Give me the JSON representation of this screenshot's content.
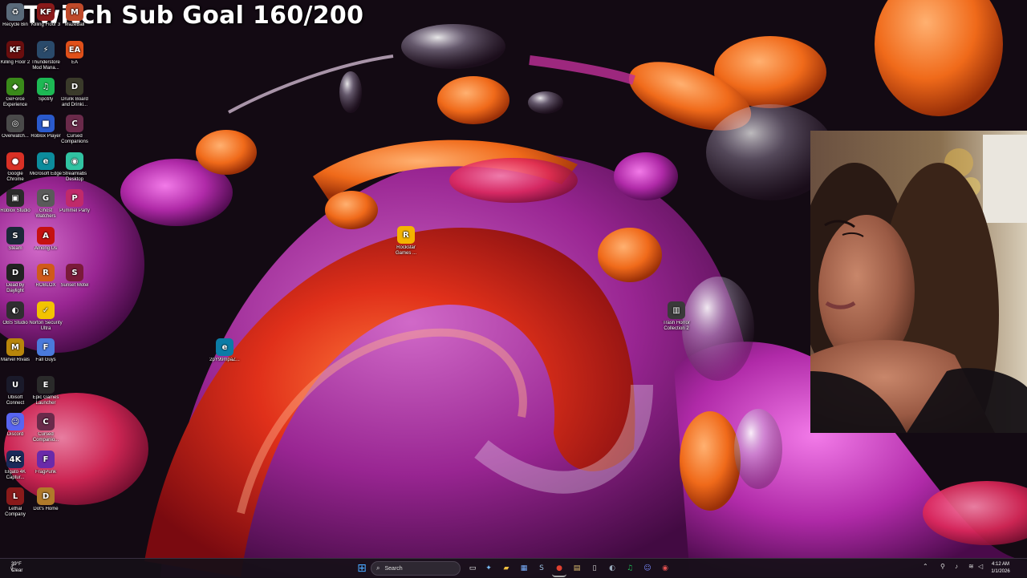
{
  "overlay": {
    "title": "Twitch Sub Goal 160/200"
  },
  "desktop": {
    "icons": [
      {
        "id": "recycle-bin",
        "label": "Recycle Bin",
        "glyph": "♻",
        "color": "#5a6a7a"
      },
      {
        "id": "killing-floor-3",
        "label": "Killing Floor 3",
        "glyph": "KF",
        "color": "#8a1a1a"
      },
      {
        "id": "mazeball",
        "label": "MazeBall",
        "glyph": "M",
        "color": "#c04a2a"
      },
      {
        "id": "killing-floor-2",
        "label": "Killing Floor 2",
        "glyph": "KF",
        "color": "#6a0e0e"
      },
      {
        "id": "thunderstore",
        "label": "Thunderstore Mod Mana...",
        "glyph": "⚡",
        "color": "#2a4a6a"
      },
      {
        "id": "ea",
        "label": "EA",
        "glyph": "EA",
        "color": "#e0501a"
      },
      {
        "id": "geforce",
        "label": "GeForce Experience",
        "glyph": "◆",
        "color": "#3a8a1a"
      },
      {
        "id": "spotify",
        "label": "Spotify",
        "glyph": "♫",
        "color": "#1db954"
      },
      {
        "id": "drunk-board",
        "label": "Drunk Board and Drinki...",
        "glyph": "D",
        "color": "#3a3a2a"
      },
      {
        "id": "overwatch",
        "label": "Overwatch...",
        "glyph": "◎",
        "color": "#4a4a4a"
      },
      {
        "id": "roblox",
        "label": "Roblox Player",
        "glyph": "■",
        "color": "#2a5acc"
      },
      {
        "id": "cursed-companions",
        "label": "Cursed Companions",
        "glyph": "C",
        "color": "#6a2a4a"
      },
      {
        "id": "chrome",
        "label": "Google Chrome",
        "glyph": "●",
        "color": "#d93025"
      },
      {
        "id": "edge",
        "label": "Microsoft Edge",
        "glyph": "e",
        "color": "#0c8c9c"
      },
      {
        "id": "streamlabs",
        "label": "Streamlabs Desktop",
        "glyph": "◉",
        "color": "#31c3a2"
      },
      {
        "id": "roblox-studio",
        "label": "Roblox Studio",
        "glyph": "▣",
        "color": "#2a2a2a"
      },
      {
        "id": "ghost-watchers",
        "label": "Ghost Watchers",
        "glyph": "G",
        "color": "#5a5a5a"
      },
      {
        "id": "pummel-party",
        "label": "Pummel Party",
        "glyph": "P",
        "color": "#c02a6a"
      },
      {
        "id": "steam",
        "label": "Steam",
        "glyph": "S",
        "color": "#1b2838"
      },
      {
        "id": "among-us",
        "label": "Among Us",
        "glyph": "A",
        "color": "#c51111"
      },
      {
        "id": "dead-by-daylight",
        "label": "Dead by Daylight",
        "glyph": "D",
        "color": "#222222"
      },
      {
        "id": "roblox-2",
        "label": "ROBLOX",
        "glyph": "R",
        "color": "#d05a1a"
      },
      {
        "id": "sunset-motel",
        "label": "Sunset Motel",
        "glyph": "S",
        "color": "#7a1a3a"
      },
      {
        "id": "obs",
        "label": "OBS Studio",
        "glyph": "◐",
        "color": "#302e31"
      },
      {
        "id": "norton",
        "label": "Norton Security Ultra",
        "glyph": "✓",
        "color": "#f2c300"
      },
      {
        "id": "marvel-rivals",
        "label": "Marvel Rivals",
        "glyph": "M",
        "color": "#b8860b"
      },
      {
        "id": "fall-guys",
        "label": "Fall Guys",
        "glyph": "F",
        "color": "#4a7adc"
      },
      {
        "id": "ubisoft",
        "label": "Ubisoft Connect",
        "glyph": "U",
        "color": "#1a1a2a"
      },
      {
        "id": "epic",
        "label": "Epic Games Launcher",
        "glyph": "E",
        "color": "#2a2a2a"
      },
      {
        "id": "discord",
        "label": "Discord",
        "glyph": "☺",
        "color": "#5865f2"
      },
      {
        "id": "cursed-companions-2",
        "label": "Cursed Companio...",
        "glyph": "C",
        "color": "#6a2a4a"
      },
      {
        "id": "elgato",
        "label": "Elgato 4K Captur...",
        "glyph": "4K",
        "color": "#1a2a5a"
      },
      {
        "id": "fragpunk",
        "label": "FragPunk",
        "glyph": "F",
        "color": "#6a2aaa"
      },
      {
        "id": "lethal-company",
        "label": "Lethal Company",
        "glyph": "L",
        "color": "#8a1a1a"
      },
      {
        "id": "dots-home",
        "label": "Dot's Home",
        "glyph": "D",
        "color": "#b07a2a"
      },
      {
        "id": "rockstar",
        "label": "Rockstar Games ...",
        "glyph": "R",
        "color": "#f4b400"
      },
      {
        "id": "zip-file",
        "label": "2pY99mpaZ...",
        "glyph": "e",
        "color": "#0c7ca6"
      },
      {
        "id": "trash-horror",
        "label": "Trash Horror Collection 2",
        "glyph": "▥",
        "color": "#3a3a3a"
      }
    ]
  },
  "taskbar": {
    "weather_temp": "39°F",
    "weather_cond": "Clear",
    "search_placeholder": "Search",
    "time": "4:12 AM",
    "date": "1/1/2026"
  },
  "colors": {
    "accent": "#ff5a1a",
    "magenta": "#c0309a",
    "background": "#140c14"
  }
}
